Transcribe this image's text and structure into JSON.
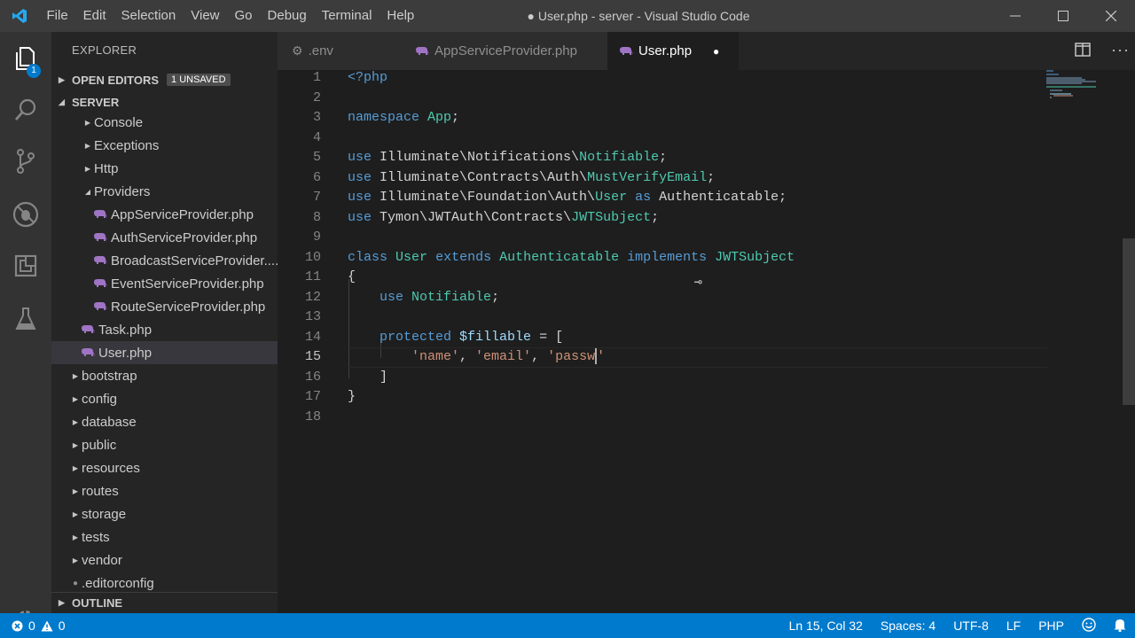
{
  "menu": [
    "File",
    "Edit",
    "Selection",
    "View",
    "Go",
    "Debug",
    "Terminal",
    "Help"
  ],
  "window_title": "● User.php - server - Visual Studio Code",
  "activity": {
    "explorer_badge": "1"
  },
  "sidebar": {
    "title": "EXPLORER",
    "open_editors": {
      "label": "OPEN EDITORS",
      "badge": "1 UNSAVED"
    },
    "server": {
      "label": "SERVER"
    },
    "tree": [
      {
        "label": "Console",
        "type": "folder",
        "state": "collapsed"
      },
      {
        "label": "Exceptions",
        "type": "folder",
        "state": "collapsed"
      },
      {
        "label": "Http",
        "type": "folder",
        "state": "collapsed"
      },
      {
        "label": "Providers",
        "type": "folder",
        "state": "expanded"
      },
      {
        "label": "AppServiceProvider.php",
        "type": "php"
      },
      {
        "label": "AuthServiceProvider.php",
        "type": "php"
      },
      {
        "label": "BroadcastServiceProvider....",
        "type": "php"
      },
      {
        "label": "EventServiceProvider.php",
        "type": "php"
      },
      {
        "label": "RouteServiceProvider.php",
        "type": "php"
      },
      {
        "label": "Task.php",
        "type": "php"
      },
      {
        "label": "User.php",
        "type": "php",
        "selected": true
      },
      {
        "label": "bootstrap",
        "type": "folder",
        "state": "collapsed"
      },
      {
        "label": "config",
        "type": "folder",
        "state": "collapsed"
      },
      {
        "label": "database",
        "type": "folder",
        "state": "collapsed"
      },
      {
        "label": "public",
        "type": "folder",
        "state": "collapsed"
      },
      {
        "label": "resources",
        "type": "folder",
        "state": "collapsed"
      },
      {
        "label": "routes",
        "type": "folder",
        "state": "collapsed"
      },
      {
        "label": "storage",
        "type": "folder",
        "state": "collapsed"
      },
      {
        "label": "tests",
        "type": "folder",
        "state": "collapsed"
      },
      {
        "label": "vendor",
        "type": "folder",
        "state": "collapsed"
      },
      {
        "label": ".editorconfig",
        "type": "config"
      }
    ],
    "outline": {
      "label": "OUTLINE"
    }
  },
  "tabs": [
    {
      "label": ".env",
      "icon": "gear-icon"
    },
    {
      "label": "AppServiceProvider.php",
      "icon": "php-icon"
    },
    {
      "label": "User.php",
      "icon": "php-icon",
      "active": true,
      "dirty": true
    }
  ],
  "editor": {
    "active_line": 15,
    "lines": [
      "<?php",
      "",
      "namespace App;",
      "",
      "use Illuminate\\Notifications\\Notifiable;",
      "use Illuminate\\Contracts\\Auth\\MustVerifyEmail;",
      "use Illuminate\\Foundation\\Auth\\User as Authenticatable;",
      "use Tymon\\JWTAuth\\Contracts\\JWTSubject;",
      "",
      "class User extends Authenticatable implements JWTSubject",
      "{",
      "    use Notifiable;",
      "",
      "    protected $fillable = [",
      "        'name', 'email', 'passw'",
      "    ]",
      "}",
      ""
    ]
  },
  "status": {
    "errors": "0",
    "warnings": "0",
    "position": "Ln 15, Col 32",
    "spaces": "Spaces: 4",
    "encoding": "UTF-8",
    "eol": "LF",
    "language": "PHP"
  }
}
